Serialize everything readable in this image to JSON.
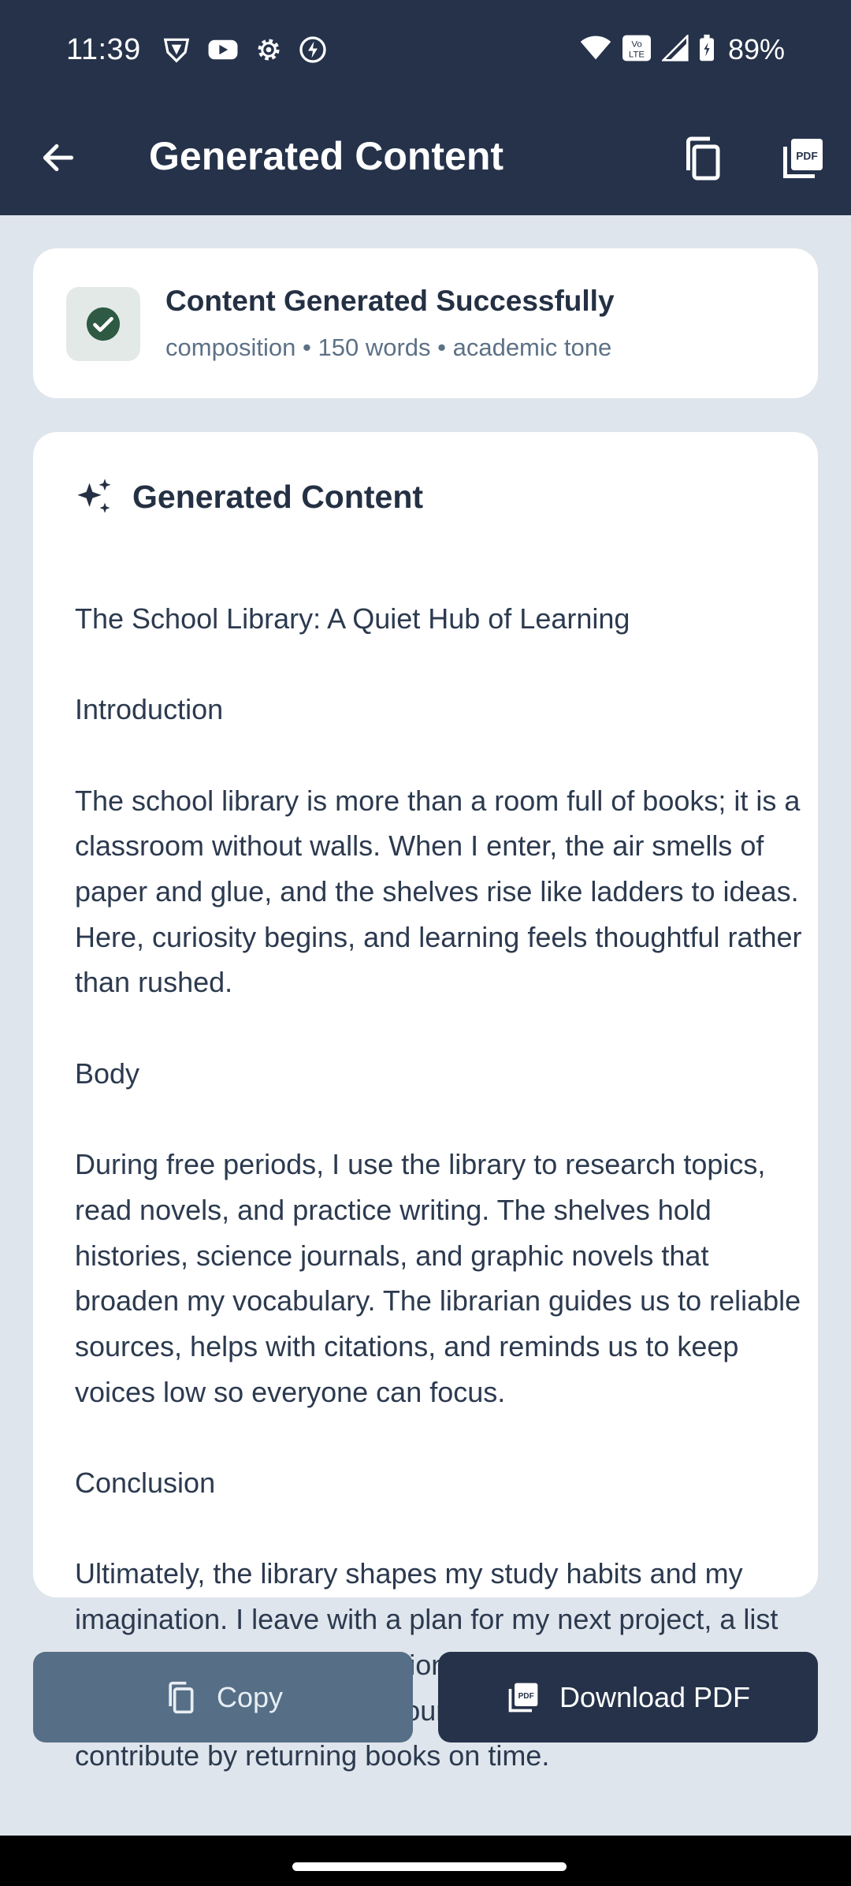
{
  "status_bar": {
    "time": "11:39",
    "battery": "89%",
    "network_badge": "Vo LTE"
  },
  "app_bar": {
    "title": "Generated Content"
  },
  "success_card": {
    "title": "Content Generated Successfully",
    "meta": "composition • 150 words • academic tone",
    "accent_color": "#2e5a43"
  },
  "content_card": {
    "heading": "Generated Content",
    "paragraphs": [
      "The School Library: A Quiet Hub of Learning",
      "Introduction",
      "The school library is more than a room full of books; it is a classroom without walls. When I enter, the air smells of paper and glue, and the shelves rise like ladders to ideas. Here, curiosity begins, and learning feels thoughtful rather than rushed.",
      "Body",
      "During free periods, I use the library to research topics, read novels, and practice writing. The shelves hold histories, science journals, and graphic novels that broaden my vocabulary. The librarian guides us to reliable sources, helps with citations, and reminds us to keep voices low so everyone can focus.",
      "Conclusion",
      "Ultimately, the library shapes my study habits and my imagination. I leave with a plan for my next project, a list of new book recommendations, and a sense that knowledge is a shared resource. I respect the space and contribute by returning books on time."
    ]
  },
  "actions": {
    "copy_label": "Copy",
    "download_label": "Download PDF"
  },
  "colors": {
    "header_bg": "#25324a",
    "page_bg": "#dfe5ec",
    "copy_button_bg": "#566f86"
  }
}
